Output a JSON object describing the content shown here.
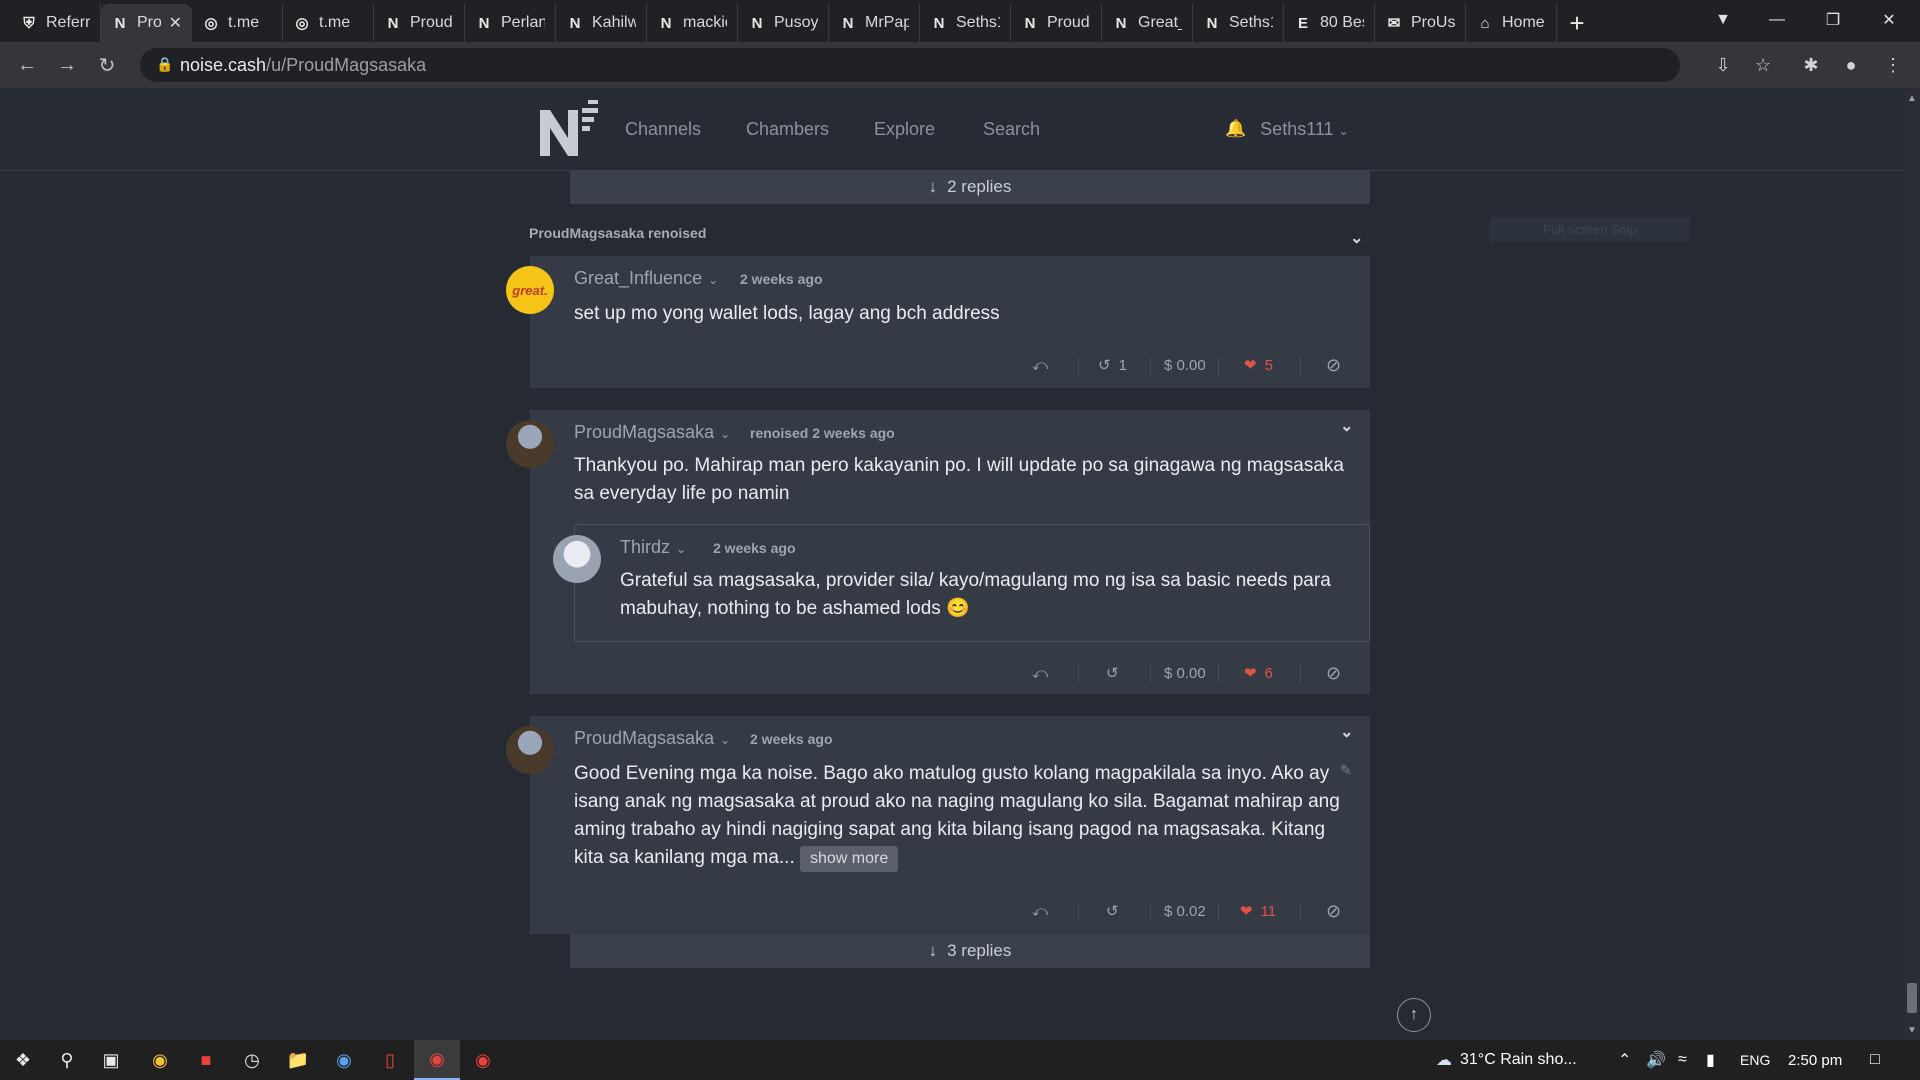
{
  "browser": {
    "tabs": [
      {
        "label": "Referr",
        "icon": "shield-icon"
      },
      {
        "label": "Pro",
        "icon": "noise-icon",
        "active": true
      },
      {
        "label": "t.me",
        "icon": "globe-icon"
      },
      {
        "label": "t.me",
        "icon": "globe-icon"
      },
      {
        "label": "Proud",
        "icon": "noise-icon"
      },
      {
        "label": "Perlan",
        "icon": "noise-icon"
      },
      {
        "label": "Kahilw",
        "icon": "noise-icon"
      },
      {
        "label": "mackie",
        "icon": "noise-icon"
      },
      {
        "label": "Pusoy",
        "icon": "noise-icon"
      },
      {
        "label": "MrPap",
        "icon": "noise-icon"
      },
      {
        "label": "Seths1",
        "icon": "noise-icon"
      },
      {
        "label": "Proud",
        "icon": "noise-icon"
      },
      {
        "label": "Great_",
        "icon": "noise-icon"
      },
      {
        "label": "Seths1",
        "icon": "noise-icon"
      },
      {
        "label": "80 Bes",
        "icon": "e-icon"
      },
      {
        "label": "ProUs",
        "icon": "mail-icon"
      },
      {
        "label": "Home",
        "icon": "home-icon"
      }
    ],
    "url_host": "noise.cash",
    "url_path": "/u/ProudMagsasaka"
  },
  "site": {
    "nav": [
      "Channels",
      "Chambers",
      "Explore",
      "Search"
    ],
    "username": "Seths111"
  },
  "top_replies_label": "2 replies",
  "renoise_label": "ProudMagsasaka renoised",
  "ghost_button": "Full-screen Snip",
  "posts": [
    {
      "author": "Great_Influence",
      "avatar_text": "great.",
      "meta": "2 weeks ago",
      "text": "set up mo yong wallet lods, lagay ang bch address",
      "renoise_count": "1",
      "tip": "$ 0.00",
      "likes": "5"
    },
    {
      "author": "ProudMagsasaka",
      "meta": "renoised 2 weeks ago",
      "text": "Thankyou po. Mahirap man pero kakayanin po. I will update po sa ginagawa ng magsasaka sa everyday life po namin",
      "quote": {
        "author": "Thirdz",
        "meta": "2 weeks ago",
        "text": "Grateful sa magsasaka, provider sila/ kayo/magulang mo ng isa sa basic needs para mabuhay, nothing to be ashamed lods 😊"
      },
      "tip": "$ 0.00",
      "likes": "6"
    },
    {
      "author": "ProudMagsasaka",
      "meta": "2 weeks ago",
      "text": "Good Evening mga ka noise. Bago ako matulog gusto kolang magpakilala sa inyo. Ako ay isang anak ng magsasaka at proud ako na naging magulang ko sila. Bagamat mahirap ang aming trabaho ay hindi nagiging sapat ang kita bilang isang pagod na magsasaka. Kitang kita sa kanilang mga ma...",
      "show_more": "show more",
      "tip": "$ 0.02",
      "likes": "11",
      "replies_label": "3 replies"
    }
  ],
  "taskbar": {
    "weather": "31°C  Rain sho...",
    "lang": "ENG",
    "time": "2:50 pm"
  },
  "colors": {
    "accent_red": "#e0534a",
    "card": "#353b45",
    "page": "#262b33"
  }
}
